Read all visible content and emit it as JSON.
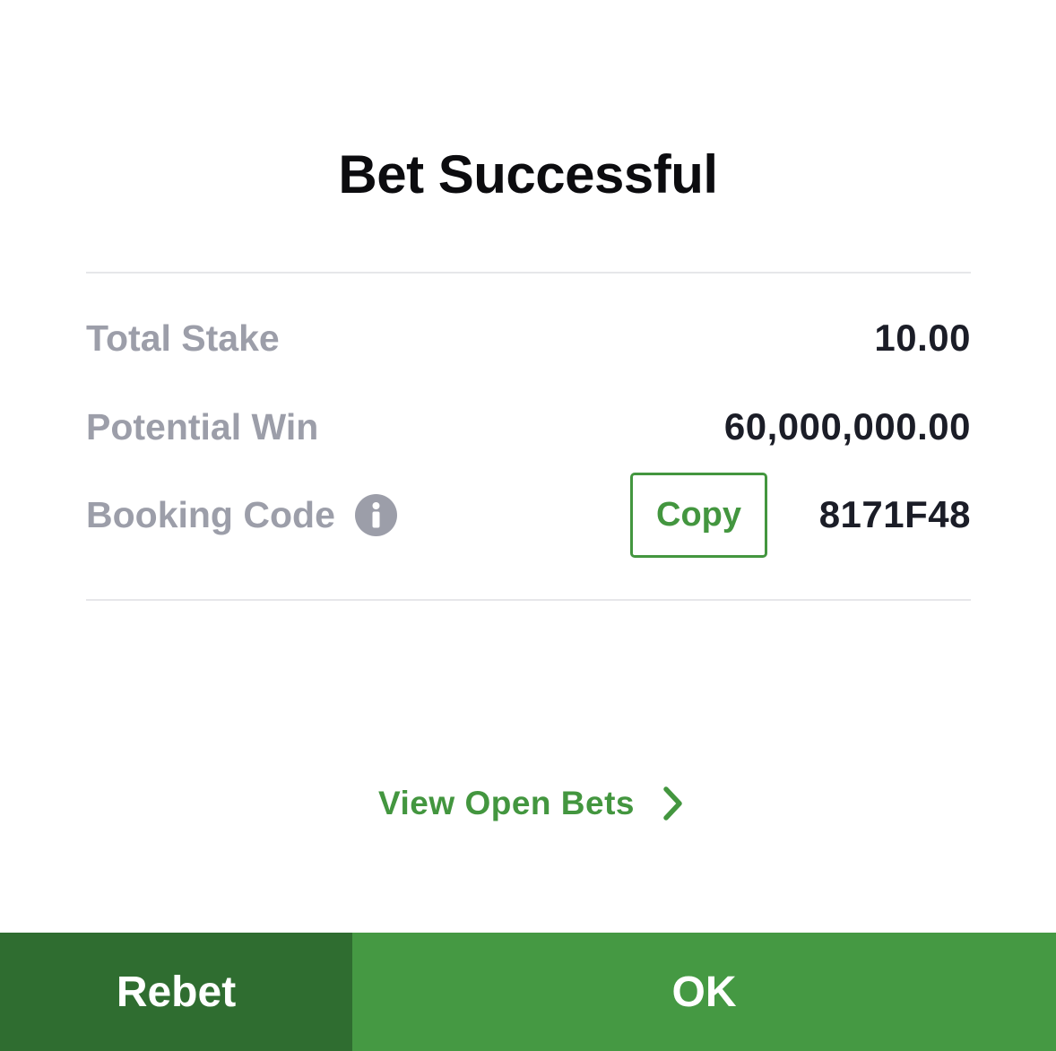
{
  "dialog": {
    "title": "Bet Successful"
  },
  "summary": {
    "total_stake_label": "Total Stake",
    "total_stake_value": "10.00",
    "potential_win_label": "Potential Win",
    "potential_win_value": "60,000,000.00",
    "booking_code_label": "Booking Code",
    "booking_code_value": "8171F48",
    "copy_label": "Copy",
    "info_icon": "info-icon"
  },
  "links": {
    "view_open_bets_label": "View Open Bets",
    "chevron_icon": "chevron-right-icon"
  },
  "actions": {
    "rebet_label": "Rebet",
    "ok_label": "OK"
  },
  "colors": {
    "accent_green": "#43963f",
    "rebet_bg": "#2f6d30",
    "ok_bg": "#459943",
    "label_gray": "#9c9ea9",
    "value_dark": "#1b1d27"
  }
}
